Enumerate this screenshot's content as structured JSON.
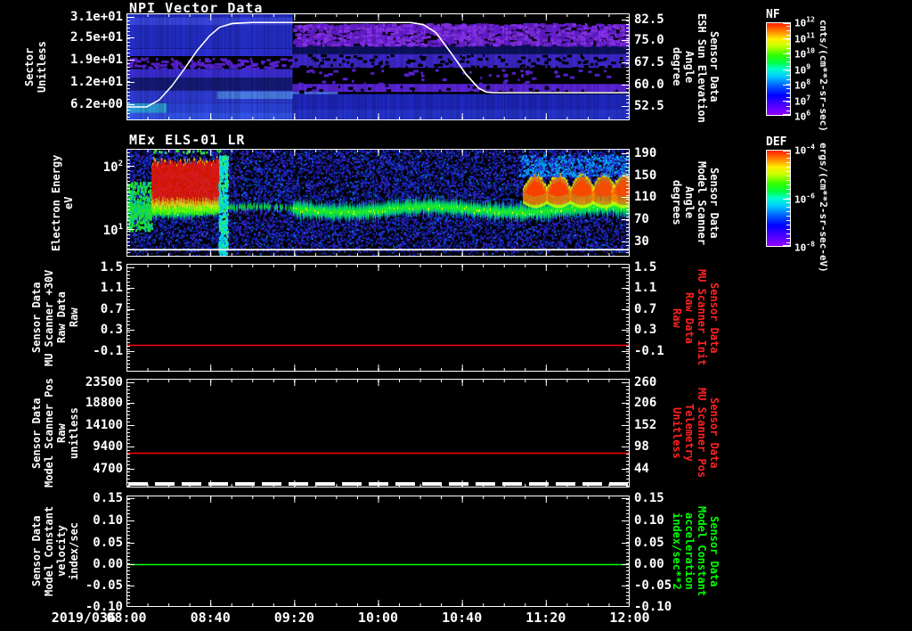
{
  "figure": {
    "background": "#000000",
    "frame_color": "#ffffff"
  },
  "date_label": "2019/036",
  "time_axis": {
    "ticks": [
      "08:00",
      "08:40",
      "09:20",
      "10:00",
      "10:40",
      "11:20",
      "12:00"
    ],
    "start_hour": 8,
    "end_hour": 12
  },
  "colorbars": [
    {
      "name": "NF",
      "ticks": [
        "10^12",
        "10^11",
        "10^10",
        "10^9",
        "10^8",
        "10^7",
        "10^6"
      ],
      "unit": "cnts/(cm**2-sr-sec)"
    },
    {
      "name": "DEF",
      "ticks": [
        "10^-4",
        "10^-6",
        "10^-8"
      ],
      "unit": "ergs/(cm**2-sr-sec-eV)"
    }
  ],
  "chart_data": [
    {
      "type": "heatmap",
      "title": "NPI Vector Data",
      "ylabel_lines": [
        "Sector",
        "Unitless"
      ],
      "yticks": [
        {
          "label": "3.1e+01",
          "f": 0.03
        },
        {
          "label": "2.5e+01",
          "f": 0.225
        },
        {
          "label": "1.9e+01",
          "f": 0.435
        },
        {
          "label": "1.2e+01",
          "f": 0.64
        },
        {
          "label": "6.2e+00",
          "f": 0.85
        }
      ],
      "y2label_lines": [
        "Sensor Data",
        "ESH Sun Elevation",
        "Angle",
        "degree"
      ],
      "y2label_color": "#ffffff",
      "y2ticks": [
        {
          "label": "82.5",
          "f": 0.06
        },
        {
          "label": "75.0",
          "f": 0.25
        },
        {
          "label": "67.5",
          "f": 0.458
        },
        {
          "label": "60.0",
          "f": 0.667
        },
        {
          "label": "52.5",
          "f": 0.867
        }
      ],
      "colorbar": "NF",
      "overlay_line": {
        "name": "ESH sun elevation angle (degree)",
        "color": "#ffffff",
        "plateau_value_deg": 81.5,
        "low_start_deg": 53.2,
        "flat_end_deg": 57.3,
        "points_xf_yf": [
          [
            0,
            0.875
          ],
          [
            0.04,
            0.875
          ],
          [
            0.065,
            0.81
          ],
          [
            0.09,
            0.68
          ],
          [
            0.115,
            0.52
          ],
          [
            0.14,
            0.35
          ],
          [
            0.165,
            0.21
          ],
          [
            0.185,
            0.13
          ],
          [
            0.21,
            0.095
          ],
          [
            0.25,
            0.085
          ],
          [
            0.565,
            0.085
          ],
          [
            0.59,
            0.105
          ],
          [
            0.615,
            0.18
          ],
          [
            0.645,
            0.37
          ],
          [
            0.675,
            0.57
          ],
          [
            0.7,
            0.7
          ],
          [
            0.715,
            0.735
          ],
          [
            0.73,
            0.742
          ],
          [
            1,
            0.742
          ]
        ]
      }
    },
    {
      "type": "heatmap",
      "title": "MEx ELS-01 LR",
      "ylabel_lines": [
        "Electron Energy",
        "eV"
      ],
      "yticks": [
        {
          "label": "10^2",
          "f": 0.157
        },
        {
          "label": "10^1",
          "f": 0.74
        }
      ],
      "y2label_lines": [
        "Sensor Data",
        "Model Scanner",
        "Angle",
        "degrees"
      ],
      "y2label_color": "#ffffff",
      "y2ticks": [
        {
          "label": "190",
          "f": 0.04
        },
        {
          "label": "150",
          "f": 0.245
        },
        {
          "label": "110",
          "f": 0.45
        },
        {
          "label": "70",
          "f": 0.655
        },
        {
          "label": "30",
          "f": 0.86
        }
      ],
      "colorbar": "DEF",
      "features": [
        {
          "kind": "band",
          "name": "7-25 eV ionospheric photoelectron band",
          "x": [
            0,
            1
          ],
          "fc": 0.56,
          "halfwidth": 0.085
        },
        {
          "kind": "blob",
          "name": "intense flux 08:10-08:50, 20-150 eV",
          "x": [
            0.05,
            0.185
          ],
          "y": [
            0.07,
            0.46
          ]
        },
        {
          "kind": "column",
          "name": "cold plasma column ~08:50",
          "x": [
            0.183,
            0.2
          ],
          "y": [
            0.05,
            1.0
          ]
        },
        {
          "kind": "lumps",
          "name": "flux enhancements 11:00-12:00, 20-90 eV",
          "centers": [
            0.812,
            0.858,
            0.905,
            0.949,
            0.988
          ],
          "halfwidth": 0.024,
          "y": [
            0.22,
            0.52
          ]
        }
      ],
      "overlay_line": {
        "color": "#ffffff",
        "f": 0.935
      }
    },
    {
      "type": "line",
      "title": "",
      "ylabel_lines": [
        "Sensor Data",
        "MU Scanner +30V",
        "Raw Data",
        "Raw"
      ],
      "yticks": [
        {
          "label": "1.5",
          "f": 0.03
        },
        {
          "label": "1.1",
          "f": 0.225
        },
        {
          "label": "0.7",
          "f": 0.42
        },
        {
          "label": "0.3",
          "f": 0.615
        },
        {
          "label": "-0.1",
          "f": 0.81
        }
      ],
      "y2label_lines": [
        "Sensor Data",
        "MU Scanner Init",
        "Raw Data",
        "Raw"
      ],
      "y2label_color": "#ff2222",
      "y2ticks": [
        {
          "label": "1.5",
          "f": 0.03
        },
        {
          "label": "1.1",
          "f": 0.225
        },
        {
          "label": "0.7",
          "f": 0.42
        },
        {
          "label": "0.3",
          "f": 0.615
        },
        {
          "label": "-0.1",
          "f": 0.81
        }
      ],
      "series": [
        {
          "name": "MU Scanner +30V Raw",
          "color": "#ff0000",
          "constant_value": 0.0,
          "f": 0.755
        }
      ]
    },
    {
      "type": "line",
      "title": "",
      "ylabel_lines": [
        "Sensor Data",
        "Model Scanner Pos",
        "Raw",
        "unitless"
      ],
      "yticks": [
        {
          "label": "23500",
          "f": 0.03
        },
        {
          "label": "18800",
          "f": 0.22
        },
        {
          "label": "14100",
          "f": 0.43
        },
        {
          "label": "9400",
          "f": 0.625
        },
        {
          "label": "4700",
          "f": 0.83
        }
      ],
      "y2label_lines": [
        "Sensor Data",
        "MU Scanner Pos",
        "Telemetry",
        "Unitless"
      ],
      "y2label_color": "#ff2222",
      "y2ticks": [
        {
          "label": "260",
          "f": 0.03
        },
        {
          "label": "206",
          "f": 0.22
        },
        {
          "label": "152",
          "f": 0.43
        },
        {
          "label": "98",
          "f": 0.625
        },
        {
          "label": "44",
          "f": 0.83
        }
      ],
      "series": [
        {
          "name": "Model Scanner Pos Raw",
          "color": "#ff0000",
          "constant_value": 8800,
          "f": 0.68
        }
      ],
      "marker_line": {
        "color": "#ffffff",
        "f": 0.968,
        "dash": [
          22,
          8
        ],
        "width": 4
      }
    },
    {
      "type": "line",
      "title": "",
      "ylabel_lines": [
        "Sensor Data",
        "Model Constant",
        "velocity",
        "index/sec"
      ],
      "yticks": [
        {
          "label": "0.15",
          "f": 0.025
        },
        {
          "label": "0.10",
          "f": 0.22
        },
        {
          "label": "0.05",
          "f": 0.42
        },
        {
          "label": "0.00",
          "f": 0.615
        },
        {
          "label": "-0.05",
          "f": 0.81
        },
        {
          "label": "-0.10",
          "f": 1.0
        }
      ],
      "y2label_lines": [
        "Sensor Data",
        "Model Constant",
        "acceleration",
        "index/sec**2"
      ],
      "y2label_color": "#00ff00",
      "y2ticks": [
        {
          "label": "0.15",
          "f": 0.025
        },
        {
          "label": "0.10",
          "f": 0.22
        },
        {
          "label": "0.05",
          "f": 0.42
        },
        {
          "label": "0.00",
          "f": 0.615
        },
        {
          "label": "-0.05",
          "f": 0.81
        },
        {
          "label": "-0.10",
          "f": 1.0
        }
      ],
      "series": [
        {
          "name": "Model Constant velocity",
          "color": "#00ff00",
          "constant_value": 0.0,
          "f": 0.615
        }
      ]
    }
  ]
}
